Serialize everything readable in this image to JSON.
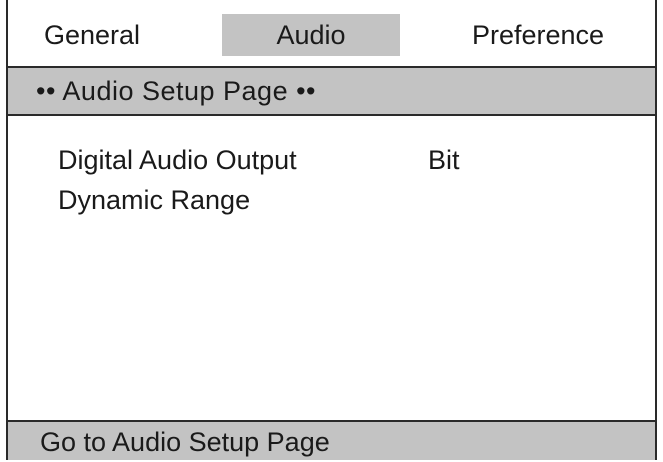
{
  "tabs": {
    "general": "General",
    "audio": "Audio",
    "preference": "Preference"
  },
  "page_header": "•• Audio Setup Page ••",
  "settings": {
    "items": [
      {
        "label": "Digital Audio Output",
        "value": "Bit"
      },
      {
        "label": "Dynamic Range",
        "value": ""
      }
    ]
  },
  "status": "Go to Audio Setup Page",
  "colors": {
    "highlight": "#c3c3c3",
    "border": "#2a2a2a",
    "background": "#ffffff"
  }
}
